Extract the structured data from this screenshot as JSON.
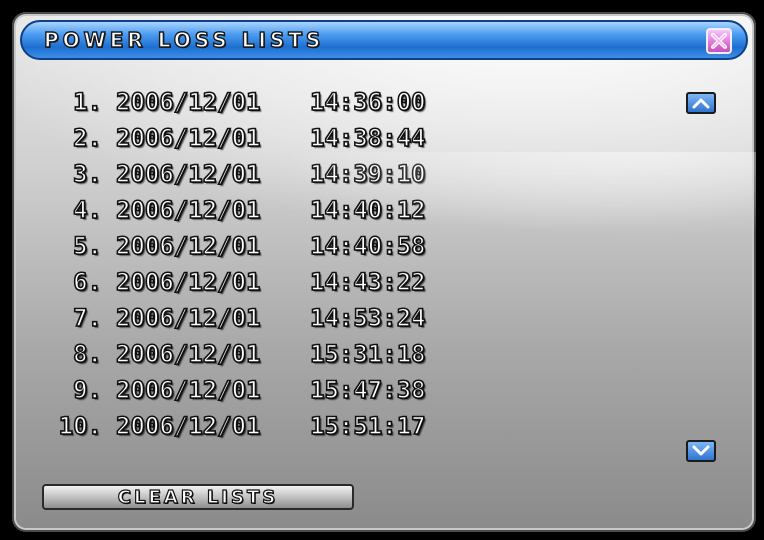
{
  "window": {
    "title": "POWER LOSS LISTS"
  },
  "entries": [
    {
      "index": "1.",
      "date": "2006/12/01",
      "time": "14:36:00"
    },
    {
      "index": "2.",
      "date": "2006/12/01",
      "time": "14:38:44"
    },
    {
      "index": "3.",
      "date": "2006/12/01",
      "time": "14:39:10"
    },
    {
      "index": "4.",
      "date": "2006/12/01",
      "time": "14:40:12"
    },
    {
      "index": "5.",
      "date": "2006/12/01",
      "time": "14:40:58"
    },
    {
      "index": "6.",
      "date": "2006/12/01",
      "time": "14:43:22"
    },
    {
      "index": "7.",
      "date": "2006/12/01",
      "time": "14:53:24"
    },
    {
      "index": "8.",
      "date": "2006/12/01",
      "time": "15:31:18"
    },
    {
      "index": "9.",
      "date": "2006/12/01",
      "time": "15:47:38"
    },
    {
      "index": "10.",
      "date": "2006/12/01",
      "time": "15:51:17"
    }
  ],
  "buttons": {
    "clear_label": "CLEAR LISTS"
  },
  "icons": {
    "close": "close-icon",
    "scroll_up": "chevron-up-icon",
    "scroll_down": "chevron-down-icon"
  },
  "colors": {
    "titlebar": "#1e6fd0",
    "close_button": "#e07ad8",
    "scroll_button": "#2f74cf",
    "panel": "#c4c4c4"
  }
}
